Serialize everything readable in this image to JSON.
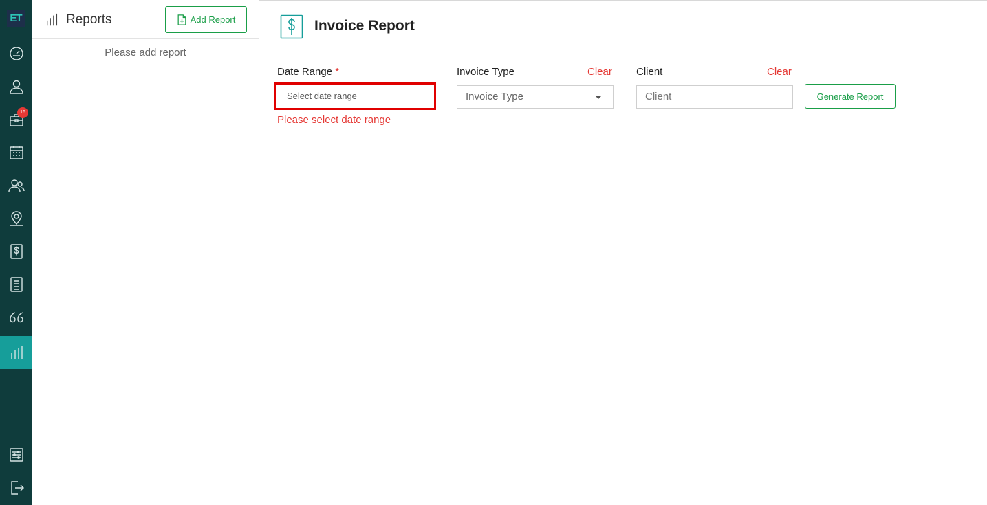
{
  "rail": {
    "logo": "ET",
    "items": [
      {
        "icon": "dashboard-icon"
      },
      {
        "icon": "user-icon"
      },
      {
        "icon": "briefcase-icon",
        "badge": "16"
      },
      {
        "icon": "calendar-icon"
      },
      {
        "icon": "users-icon"
      },
      {
        "icon": "location-icon"
      },
      {
        "icon": "invoice-icon"
      },
      {
        "icon": "list-icon"
      },
      {
        "icon": "quote-icon"
      },
      {
        "icon": "reports-icon",
        "active": true
      }
    ],
    "bottom": [
      {
        "icon": "settings-icon"
      },
      {
        "icon": "logout-icon"
      }
    ]
  },
  "reports_panel": {
    "title": "Reports",
    "add_button": "Add Report",
    "empty_text": "Please add report"
  },
  "main": {
    "title": "Invoice Report",
    "date_range": {
      "label": "Date Range",
      "required_marker": "*",
      "placeholder": "Select date range",
      "error": "Please select date range"
    },
    "invoice_type": {
      "label": "Invoice Type",
      "clear": "Clear",
      "placeholder": "Invoice Type"
    },
    "client": {
      "label": "Client",
      "clear": "Clear",
      "placeholder": "Client"
    },
    "generate_button": "Generate Report"
  },
  "colors": {
    "rail_bg": "#0f3c3c",
    "rail_active": "#169e9a",
    "accent_green": "#1a9e48",
    "error_red": "#e53935"
  }
}
